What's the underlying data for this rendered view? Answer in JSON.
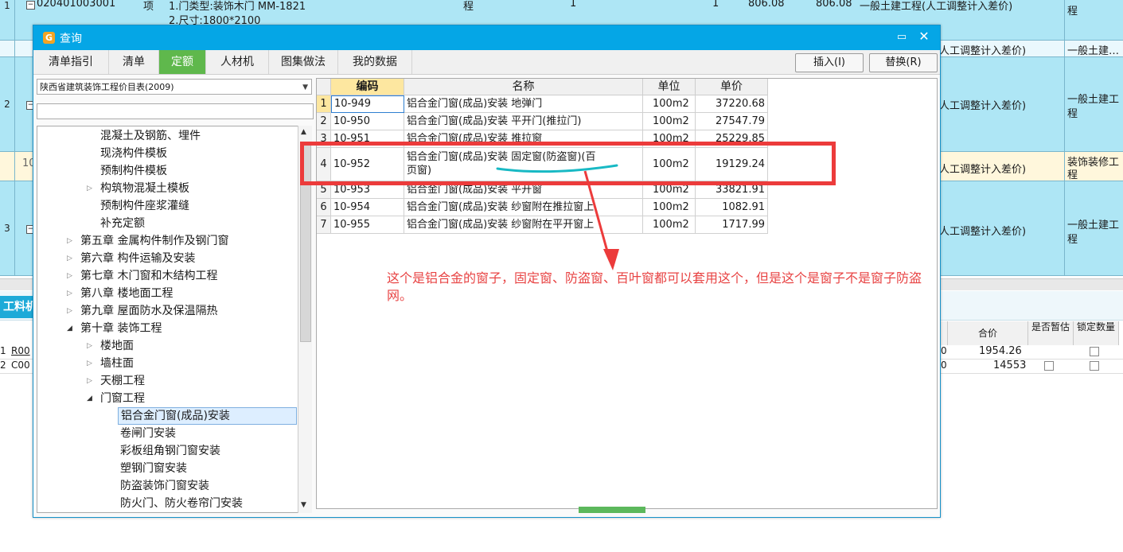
{
  "background": {
    "rows": [
      {
        "num": "1",
        "code": "020401003001",
        "kind": "项",
        "desc1": "1.门类型:装饰木门 MM-1821",
        "desc2": "2.尺寸:1800*2100",
        "unit": "程",
        "qty": "1",
        "qty2": "1",
        "price": "806.08",
        "total": "806.08",
        "remark": "一般土建工程(人工调整计入差价)",
        "tail": "程"
      },
      {
        "num": "",
        "remark": "人工调整计入差价)",
        "tail": "一般土建…"
      },
      {
        "num": "2",
        "remark": "人工调整计入差价)",
        "tail1": "一般土建工",
        "tail2": "程"
      },
      {
        "num": "10",
        "remark": "人工调整计入差价)",
        "tail1": "装饰装修工",
        "tail2": "程"
      },
      {
        "num": "3",
        "remark": "人工调整计入差价)",
        "tail1": "一般土建工",
        "tail2": "程"
      }
    ],
    "panel_tab": "工料机",
    "panel_headers": {
      "total": "合价",
      "estimate": "是否暂估",
      "lock": "锁定数量"
    },
    "panel_rows": [
      {
        "num": "1",
        "code": "R00",
        "unit_tail": "0",
        "total": "1954.26"
      },
      {
        "num": "2",
        "code": "C00",
        "unit_tail": "0",
        "total": "14553"
      }
    ]
  },
  "dialog": {
    "title": "查询",
    "max_icon": "maximize-icon",
    "close_icon": "close-icon",
    "tabs": [
      {
        "label": "清单指引"
      },
      {
        "label": "清单"
      },
      {
        "label": "定额"
      },
      {
        "label": "人材机"
      },
      {
        "label": "图集做法"
      },
      {
        "label": "我的数据"
      }
    ],
    "insert_label": "插入(I)",
    "replace_label": "替换(R)",
    "library": "陕西省建筑装饰工程价目表(2009)",
    "search_value": "",
    "tree": [
      {
        "label": "混凝土及钢筋、埋件",
        "level": 2
      },
      {
        "label": "现浇构件模板",
        "level": 2
      },
      {
        "label": "预制构件模板",
        "level": 2
      },
      {
        "label": "构筑物混凝土模板",
        "level": 2,
        "arrow": "▷"
      },
      {
        "label": "预制构件座浆灌缝",
        "level": 2
      },
      {
        "label": "补充定额",
        "level": 2
      },
      {
        "label": "第五章 金属构件制作及钢门窗",
        "level": 1,
        "arrow": "▷"
      },
      {
        "label": "第六章 构件运输及安装",
        "level": 1,
        "arrow": "▷"
      },
      {
        "label": "第七章 木门窗和木结构工程",
        "level": 1,
        "arrow": "▷"
      },
      {
        "label": "第八章 楼地面工程",
        "level": 1,
        "arrow": "▷"
      },
      {
        "label": "第九章 屋面防水及保温隔热",
        "level": 1,
        "arrow": "▷"
      },
      {
        "label": "第十章 装饰工程",
        "level": 1,
        "arrow": "◢"
      },
      {
        "label": "楼地面",
        "level": 2,
        "arrow": "▷"
      },
      {
        "label": "墙柱面",
        "level": 2,
        "arrow": "▷"
      },
      {
        "label": "天棚工程",
        "level": 2,
        "arrow": "▷"
      },
      {
        "label": "门窗工程",
        "level": 2,
        "arrow": "◢"
      },
      {
        "label": "铝合金门窗(成品)安装",
        "level": 3,
        "selected": true
      },
      {
        "label": "卷闸门安装",
        "level": 3
      },
      {
        "label": "彩板组角钢门窗安装",
        "level": 3
      },
      {
        "label": "塑钢门窗安装",
        "level": 3
      },
      {
        "label": "防盗装饰门窗安装",
        "level": 3
      },
      {
        "label": "防火门、防火卷帘门安装",
        "level": 3
      }
    ],
    "grid": {
      "headers": {
        "code": "编码",
        "name": "名称",
        "unit": "单位",
        "price": "单价"
      },
      "rows": [
        {
          "num": "1",
          "code": "10-949",
          "name": "铝合金门窗(成品)安装 地弹门",
          "unit": "100m2",
          "price": "37220.68"
        },
        {
          "num": "2",
          "code": "10-950",
          "name": "铝合金门窗(成品)安装 平开门(推拉门)",
          "unit": "100m2",
          "price": "27547.79"
        },
        {
          "num": "3",
          "code": "10-951",
          "name": "铝合金门窗(成品)安装 推拉窗",
          "unit": "100m2",
          "price": "25229.85"
        },
        {
          "num": "4",
          "code": "10-952",
          "name1": "铝合金门窗(成品)安装 固定窗(防盗窗)(百",
          "name2": "页窗)",
          "unit": "100m2",
          "price": "19129.24"
        },
        {
          "num": "5",
          "code": "10-953",
          "name": "铝合金门窗(成品)安装 平开窗",
          "unit": "100m2",
          "price": "33821.91"
        },
        {
          "num": "6",
          "code": "10-954",
          "name": "铝合金门窗(成品)安装 纱窗附在推拉窗上",
          "unit": "100m2",
          "price": "1082.91"
        },
        {
          "num": "7",
          "code": "10-955",
          "name": "铝合金门窗(成品)安装 纱窗附在平开窗上",
          "unit": "100m2",
          "price": "1717.99"
        }
      ]
    }
  },
  "annotation": {
    "text": "这个是铝合金的窗子，固定窗、防盗窗、百叶窗都可以套用这个，但是这个是窗子不是窗子防盗网。",
    "box_color": "#ec3b3b",
    "underline_color": "#18b9c4"
  }
}
